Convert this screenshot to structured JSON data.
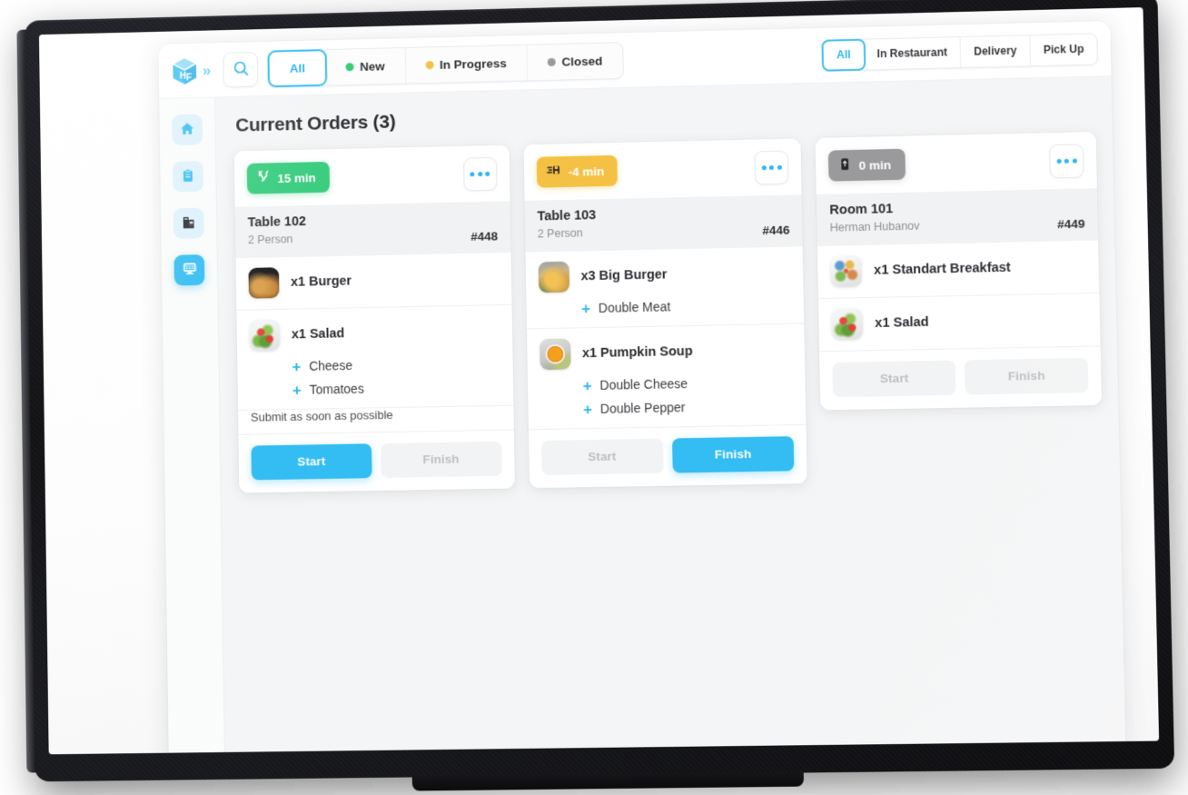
{
  "app": {
    "logo_text": "HF",
    "expand_chevron": "»"
  },
  "topbar": {
    "search_icon": "search-icon",
    "status_tabs": [
      {
        "label": "All",
        "active": true,
        "dot": null
      },
      {
        "label": "New",
        "active": false,
        "dot": "#2ecc71"
      },
      {
        "label": "In Progress",
        "active": false,
        "dot": "#f5c144"
      },
      {
        "label": "Closed",
        "active": false,
        "dot": "#9a9a9d"
      }
    ],
    "channel_tabs": [
      {
        "label": "All",
        "active": true
      },
      {
        "label": "In Restaurant",
        "active": false
      },
      {
        "label": "Delivery",
        "active": false
      },
      {
        "label": "Pick Up",
        "active": false
      }
    ]
  },
  "sidebar": {
    "items": [
      {
        "icon": "home-icon",
        "active": false
      },
      {
        "icon": "clipboard-icon",
        "active": false
      },
      {
        "icon": "coffee-machine-icon",
        "active": false
      },
      {
        "icon": "pos-display-icon",
        "active": true
      }
    ]
  },
  "main": {
    "page_title": "Current Orders (3)",
    "orders": [
      {
        "badge": {
          "text": "15 min",
          "icon": "cutlery-icon",
          "color": "#38cc7e",
          "style": "green"
        },
        "more_icon": "ellipsis-icon",
        "place": "Table 102",
        "who": "2 Person",
        "order_no": "#448",
        "items": [
          {
            "name": "x1 Burger",
            "thumb": "burger",
            "addons": []
          },
          {
            "name": "x1 Salad",
            "thumb": "salad",
            "addons": [
              "Cheese",
              "Tomatoes"
            ]
          }
        ],
        "note": "Submit as soon as possible",
        "buttons": [
          {
            "label": "Start",
            "state": "primary"
          },
          {
            "label": "Finish",
            "state": "disabled"
          }
        ]
      },
      {
        "badge": {
          "text": "-4 min",
          "icon": "delivery-scooter-icon",
          "color": "#f5c144",
          "style": "amber"
        },
        "more_icon": "ellipsis-icon",
        "place": "Table 103",
        "who": "2 Person",
        "order_no": "#446",
        "items": [
          {
            "name": "x3 Big Burger",
            "thumb": "bigburger",
            "addons": [
              "Double Meat"
            ]
          },
          {
            "name": "x1 Pumpkin Soup",
            "thumb": "soup",
            "addons": [
              "Double Cheese",
              "Double Pepper"
            ]
          }
        ],
        "note": null,
        "buttons": [
          {
            "label": "Start",
            "state": "disabled"
          },
          {
            "label": "Finish",
            "state": "primary"
          }
        ]
      },
      {
        "badge": {
          "text": "0 min",
          "icon": "takeaway-cup-icon",
          "color": "#9a9a9d",
          "style": "grey"
        },
        "more_icon": "ellipsis-icon",
        "place": "Room 101",
        "who": "Herman Hubanov",
        "order_no": "#449",
        "items": [
          {
            "name": "x1 Standart Breakfast",
            "thumb": "breakfast",
            "addons": []
          },
          {
            "name": "x1 Salad",
            "thumb": "salad",
            "addons": []
          }
        ],
        "note": null,
        "buttons": [
          {
            "label": "Start",
            "state": "disabled"
          },
          {
            "label": "Finish",
            "state": "disabled"
          }
        ]
      }
    ]
  },
  "colors": {
    "accent": "#33bdf2",
    "green": "#38cc7e",
    "amber": "#f5c144",
    "grey": "#9a9a9d",
    "text": "#2c2e32",
    "muted": "#8e9094"
  }
}
